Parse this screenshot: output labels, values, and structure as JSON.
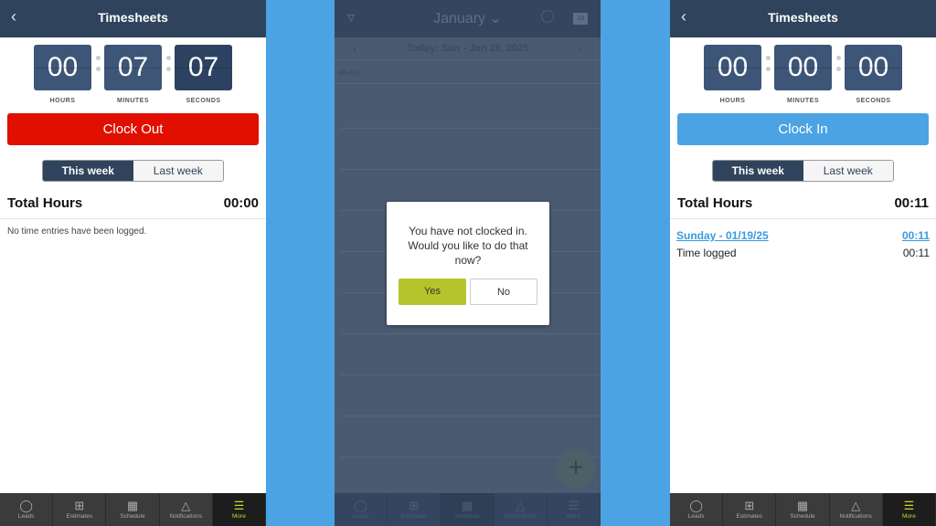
{
  "left": {
    "header": {
      "title": "Timesheets"
    },
    "timer": {
      "hours": "00",
      "minutes": "07",
      "seconds": "07",
      "hours_label": "HOURS",
      "minutes_label": "MINUTES",
      "seconds_label": "SECONDS"
    },
    "action_button": {
      "label": "Clock Out",
      "color": "#e00f00"
    },
    "toggle": {
      "this_week": "This week",
      "last_week": "Last week"
    },
    "total": {
      "label": "Total Hours",
      "value": "00:00"
    },
    "empty_message": "No time entries have been logged."
  },
  "middle": {
    "header": {
      "month": "January",
      "calendar_badge": "19"
    },
    "date_bar": {
      "label": "Today: Sun - Jan 19, 2025"
    },
    "all_day_label": "all-day",
    "dialog": {
      "message": "You have not clocked in. Would you like to do that now?",
      "yes": "Yes",
      "no": "No",
      "yes_color": "#b5c42a"
    }
  },
  "right": {
    "header": {
      "title": "Timesheets"
    },
    "timer": {
      "hours": "00",
      "minutes": "00",
      "seconds": "00",
      "hours_label": "HOURS",
      "minutes_label": "MINUTES",
      "seconds_label": "SECONDS"
    },
    "action_button": {
      "label": "Clock In",
      "color": "#4ba3e3"
    },
    "toggle": {
      "this_week": "This week",
      "last_week": "Last week"
    },
    "total": {
      "label": "Total Hours",
      "value": "00:11"
    },
    "entries": [
      {
        "day": "Sunday - 01/19/25",
        "day_total": "00:11",
        "label": "Time logged",
        "value": "00:11"
      }
    ]
  },
  "nav": {
    "items": [
      "Leads",
      "Estimates",
      "Schedule",
      "Notifications",
      "More"
    ],
    "active": "More"
  }
}
